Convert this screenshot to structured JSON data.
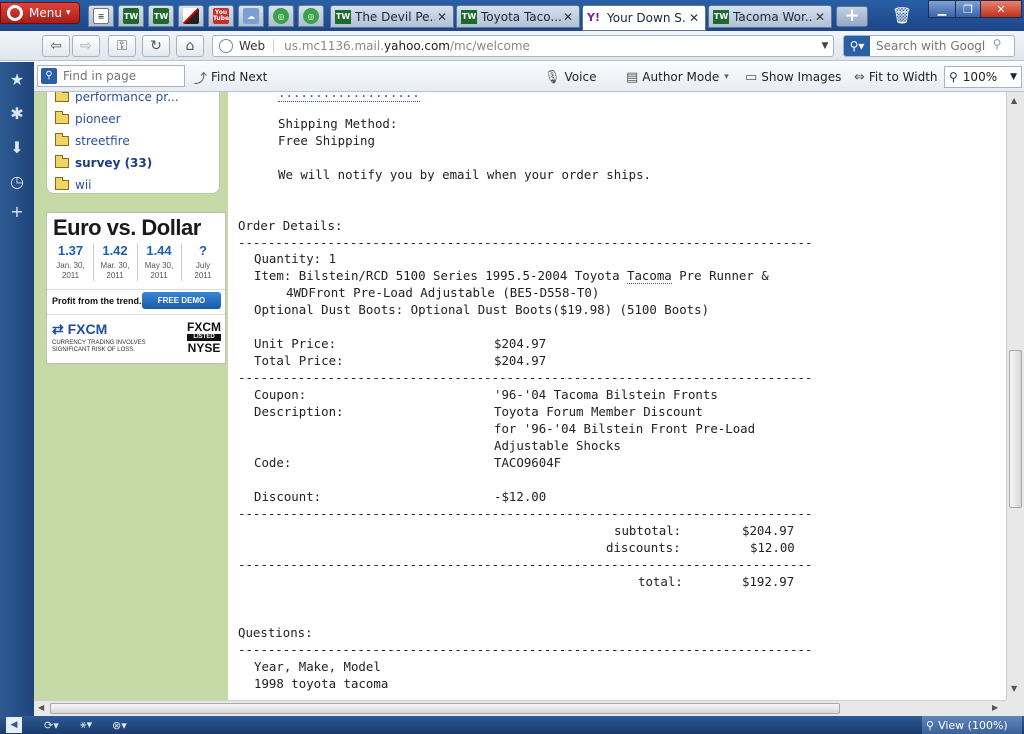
{
  "browser": {
    "menu_label": "Menu",
    "pinned_tabs": [
      {
        "icon": "notes-icon",
        "text": ""
      },
      {
        "icon": "tw-icon",
        "text": "TW"
      },
      {
        "icon": "tw-icon",
        "text": "TW"
      },
      {
        "icon": "slash-icon",
        "text": ""
      },
      {
        "icon": "youtube-icon",
        "text": "You Tube"
      },
      {
        "icon": "chat-icon",
        "text": ""
      },
      {
        "icon": "circle-icon",
        "text": ""
      },
      {
        "icon": "circle-icon",
        "text": ""
      }
    ],
    "tabs": [
      {
        "favicon": "TW",
        "label": "The Devil Pe...",
        "active": false
      },
      {
        "favicon": "TW",
        "label": "Toyota Taco...",
        "active": false
      },
      {
        "favicon": "Y!",
        "label": "Your Down S...",
        "active": true
      },
      {
        "favicon": "TW",
        "label": "Tacoma Wor...",
        "active": false
      }
    ],
    "address": {
      "web_label": "Web",
      "url_prefix": "us.mc1136.mail.",
      "url_domain": "yahoo.com",
      "url_suffix": "/mc/welcome"
    },
    "search_placeholder": "Search with Google"
  },
  "findbar": {
    "find_placeholder": "Find in page",
    "find_next": "Find Next",
    "voice": "Voice",
    "author_mode": "Author Mode",
    "show_images": "Show Images",
    "fit_to_width": "Fit to Width",
    "zoom": "100%"
  },
  "sidebar": {
    "folders": [
      {
        "label": "performance pr...",
        "bold": false
      },
      {
        "label": "pioneer",
        "bold": false
      },
      {
        "label": "streetfire",
        "bold": false
      },
      {
        "label": "survey (33)",
        "bold": true
      },
      {
        "label": "wii",
        "bold": false
      }
    ]
  },
  "ad": {
    "headline": "Euro vs. Dollar",
    "rates": [
      {
        "value": "1.37",
        "date1": "Jan. 30,",
        "date2": "2011"
      },
      {
        "value": "1.42",
        "date1": "Mar. 30,",
        "date2": "2011"
      },
      {
        "value": "1.44",
        "date1": "May 30,",
        "date2": "2011"
      },
      {
        "value": "?",
        "date1": "July",
        "date2": "2011"
      }
    ],
    "tagline": "Profit from the trend.",
    "cta": "FREE DEMO",
    "brand": "FXCM",
    "risk_line1": "CURRENCY TRADING INVOLVES",
    "risk_line2": "SIGNIFICANT RISK OF LOSS.",
    "exchange_brand": "FXCM",
    "exchange_listed": "LISTED",
    "exchange_name": "NYSE"
  },
  "email": {
    "top_dots": "...................",
    "shipping_method_label": "Shipping Method:",
    "shipping_method_value": "Free Shipping",
    "notify": "We will notify you by email when your order ships.",
    "order_details_heading": "Order Details:",
    "rule": "-------------------------------------------------------------------------------",
    "quantity": "Quantity: 1",
    "item_line1_before": "Item: Bilstein/RCD 5100 Series 1995.5-2004 Toyota ",
    "item_line1_link": "Tacoma",
    "item_line1_after": " Pre Runner &",
    "item_line2": "4WDFront Pre-Load Adjustable (BE5-D558-T0)",
    "options": "Optional Dust Boots: Optional Dust Boots($19.98) (5100 Boots)",
    "unit_price_label": "Unit Price:",
    "unit_price_value": "$204.97",
    "total_price_label": "Total Price:",
    "total_price_value": "$204.97",
    "coupon_label": "Coupon:",
    "coupon_value": "'96-'04 Tacoma Bilstein Fronts",
    "description_label": "Description:",
    "description_lines": [
      "Toyota Forum Member Discount",
      "for '96-'04 Bilstein Front Pre-Load",
      "Adjustable Shocks"
    ],
    "code_label": "Code:",
    "code_value": "TACO9604F",
    "discount_label": "Discount:",
    "discount_value": "-$12.00",
    "subtotal_label": "subtotal:",
    "subtotal_value": "$204.97",
    "discounts_label": "discounts:",
    "discounts_value": "$12.00",
    "total_label": "total:",
    "total_value": "$192.97",
    "questions_heading": "Questions:",
    "question_label": "Year, Make, Model",
    "question_answer": "1998 toyota tacoma"
  },
  "status": {
    "view_label": "View (100%)"
  }
}
